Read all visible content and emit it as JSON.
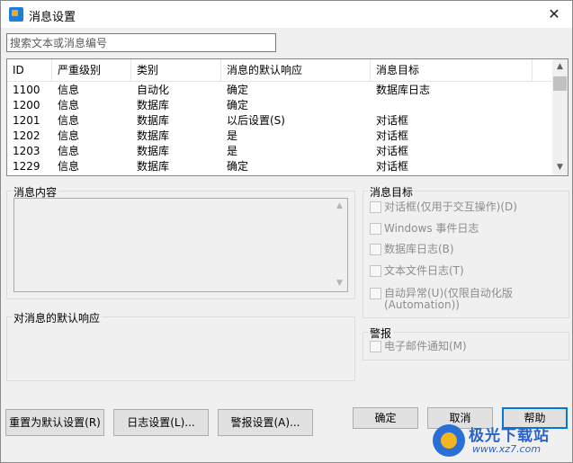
{
  "window": {
    "title": "消息设置",
    "close_glyph": "✕"
  },
  "search": {
    "placeholder": "搜索文本或消息编号",
    "value": ""
  },
  "table": {
    "columns": [
      "ID",
      "严重级别",
      "类别",
      "消息的默认响应",
      "消息目标"
    ],
    "rows": [
      [
        "1100",
        "信息",
        "自动化",
        "确定",
        "数据库日志"
      ],
      [
        "1200",
        "信息",
        "数据库",
        "确定",
        ""
      ],
      [
        "1201",
        "信息",
        "数据库",
        "以后设置(S)",
        "对话框"
      ],
      [
        "1202",
        "信息",
        "数据库",
        "是",
        "对话框"
      ],
      [
        "1203",
        "信息",
        "数据库",
        "是",
        "对话框"
      ],
      [
        "1229",
        "信息",
        "数据库",
        "确定",
        "对话框"
      ]
    ]
  },
  "message_content": {
    "label": "消息内容"
  },
  "default_response": {
    "label": "对消息的默认响应"
  },
  "targets": {
    "label": "消息目标",
    "options": [
      "对话框(仅用于交互操作)(D)",
      "Windows 事件日志",
      "数据库日志(B)",
      "文本文件日志(T)",
      "自动异常(U)(仅限自动化版",
      "(Automation))"
    ]
  },
  "alert": {
    "label": "警报",
    "option": "电子邮件通知(M)"
  },
  "buttons": {
    "reset": "重置为默认设置(R)",
    "log_settings": "日志设置(L)...",
    "alert_settings": "警报设置(A)...",
    "ok": "确定",
    "cancel": "取消",
    "help": "帮助"
  },
  "watermark": {
    "text": "极光下载站",
    "url": "www.xz7.com"
  },
  "colors": {
    "default_button_border": "#0078d7",
    "watermark": "#2a63c9"
  }
}
